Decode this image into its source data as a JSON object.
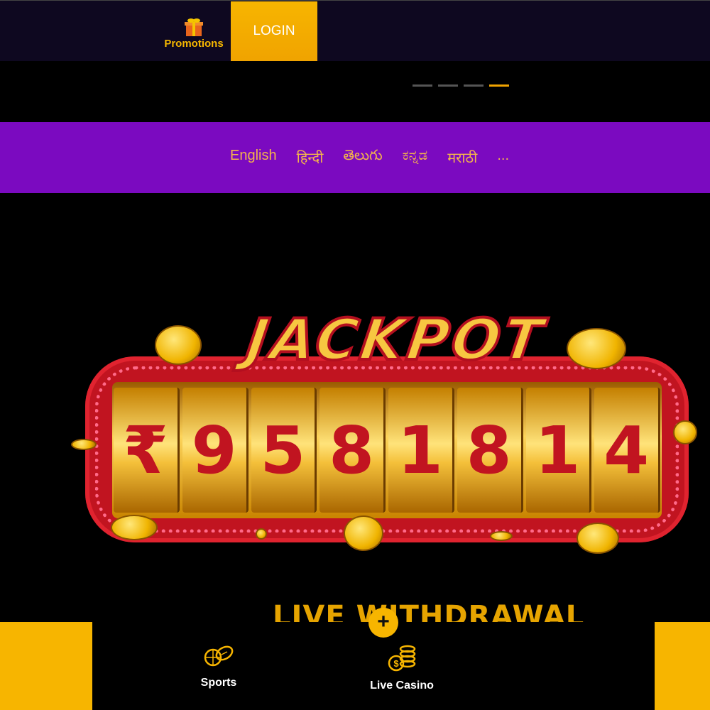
{
  "header": {
    "promotions_label": "Promotions",
    "login_label": "LOGIN",
    "promotions_icon": "gift-icon"
  },
  "carousel": {
    "slide_count": 4,
    "active_index": 3
  },
  "languages": [
    "English",
    "हिन्दी",
    "తెలుగు",
    "ಕನ್ನಡ",
    "मराठी",
    "..."
  ],
  "jackpot": {
    "title": "JACKPOT",
    "digits": [
      "₹",
      "9",
      "5",
      "8",
      "1",
      "8",
      "1",
      "4"
    ]
  },
  "live_withdrawal": {
    "heading": "LIVE WITHDRAWAL"
  },
  "bottom_nav": {
    "plus_label": "+",
    "items": [
      {
        "label": "Sports",
        "icon": "sports-balls-icon"
      },
      {
        "label": "Live Casino",
        "icon": "coin-stack-icon"
      }
    ]
  },
  "colors": {
    "accent": "#f7b500",
    "language_bar": "#7b0ac0",
    "language_text": "#f3b44c",
    "topbar": "#0e0820"
  }
}
